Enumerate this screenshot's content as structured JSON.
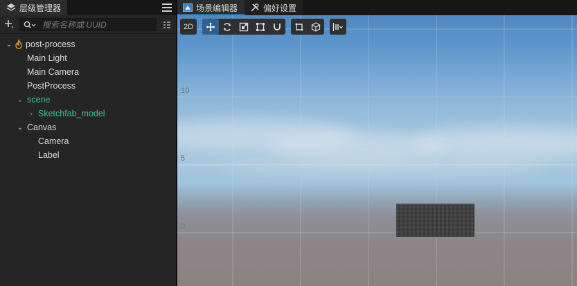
{
  "hierarchy_panel": {
    "tab_label": "层级管理器",
    "search": {
      "value": "",
      "placeholder": "搜索名称或 UUID"
    },
    "tree": [
      {
        "label": "post-process",
        "depth": 0,
        "expanded": true,
        "kind": "scene-root"
      },
      {
        "label": "Main Light",
        "depth": 1,
        "kind": "node"
      },
      {
        "label": "Main Camera",
        "depth": 1,
        "kind": "node"
      },
      {
        "label": "PostProcess",
        "depth": 1,
        "kind": "node"
      },
      {
        "label": "scene",
        "depth": 1,
        "expanded": true,
        "kind": "prefab"
      },
      {
        "label": "Sketchfab_model",
        "depth": 2,
        "expanded": false,
        "kind": "prefab"
      },
      {
        "label": "Canvas",
        "depth": 1,
        "expanded": true,
        "kind": "node"
      },
      {
        "label": "Camera",
        "depth": 2,
        "kind": "node"
      },
      {
        "label": "Label",
        "depth": 2,
        "kind": "node"
      }
    ]
  },
  "scene_panel": {
    "tabs": [
      {
        "label": "场景编辑器",
        "active": true,
        "icon": "scene-editor-icon"
      },
      {
        "label": "偏好设置",
        "active": false,
        "icon": "tools-icon"
      }
    ],
    "toolbar": {
      "mode_label": "2D",
      "transform_tools": [
        "move-icon",
        "rotate-icon",
        "scale-icon",
        "rect-icon",
        "snap-magnet-icon"
      ],
      "coord_tools": [
        "local-pivot-icon",
        "global-cube-icon"
      ],
      "align_tool": "align-icon"
    },
    "axis_labels": [
      "10",
      "5",
      "0"
    ]
  },
  "colors": {
    "accent": "#2f5f8c",
    "prefab_green": "#3fc28f",
    "panel_bg": "#252525"
  }
}
